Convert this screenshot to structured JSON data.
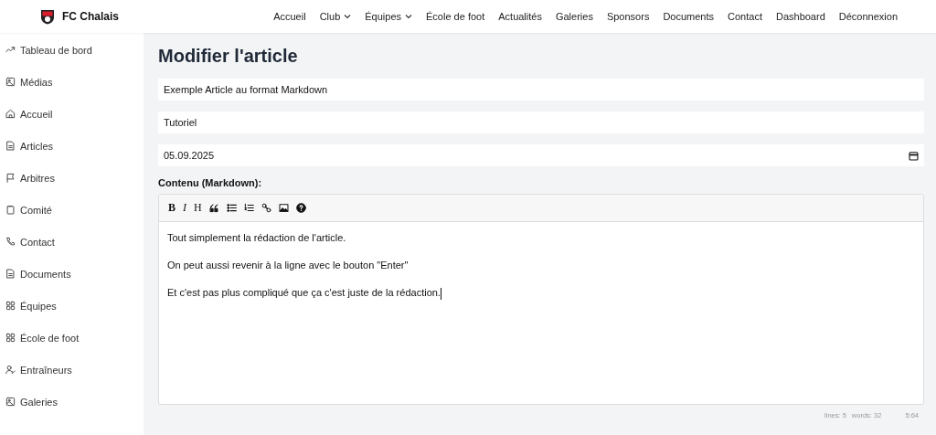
{
  "brand": {
    "name": "FC Chalais"
  },
  "nav": [
    {
      "label": "Accueil",
      "dropdown": false
    },
    {
      "label": "Club",
      "dropdown": true
    },
    {
      "label": "Équipes",
      "dropdown": true
    },
    {
      "label": "École de foot",
      "dropdown": false
    },
    {
      "label": "Actualités",
      "dropdown": false
    },
    {
      "label": "Galeries",
      "dropdown": false
    },
    {
      "label": "Sponsors",
      "dropdown": false
    },
    {
      "label": "Documents",
      "dropdown": false
    },
    {
      "label": "Contact",
      "dropdown": false
    },
    {
      "label": "Dashboard",
      "dropdown": false
    },
    {
      "label": "Déconnexion",
      "dropdown": false
    }
  ],
  "sidebar": {
    "items": [
      {
        "label": "Tableau de bord",
        "kind": "chart"
      },
      {
        "label": "Médias",
        "kind": "image"
      },
      {
        "label": "Accueil",
        "kind": "home"
      },
      {
        "label": "Articles",
        "kind": "document"
      },
      {
        "label": "Arbitres",
        "kind": "flag"
      },
      {
        "label": "Comité",
        "kind": "clipboard"
      },
      {
        "label": "Contact",
        "kind": "phone"
      },
      {
        "label": "Documents",
        "kind": "document"
      },
      {
        "label": "Équipes",
        "kind": "grid"
      },
      {
        "label": "École de foot",
        "kind": "grid"
      },
      {
        "label": "Entraîneurs",
        "kind": "user"
      },
      {
        "label": "Galeries",
        "kind": "image"
      }
    ]
  },
  "page": {
    "title": "Modifier l'article"
  },
  "form": {
    "title_field": {
      "value": "Exemple Article au format Markdown"
    },
    "category_field": {
      "value": "Tutoriel"
    },
    "date_field": {
      "value": "05.09.2025"
    },
    "content_label": "Contenu (Markdown):",
    "toolbar": [
      {
        "kind": "bold",
        "label": "B"
      },
      {
        "kind": "italic",
        "label": "I"
      },
      {
        "kind": "heading",
        "label": "H"
      },
      {
        "kind": "quote"
      },
      {
        "kind": "bullets"
      },
      {
        "kind": "numbers"
      },
      {
        "kind": "link"
      },
      {
        "kind": "image"
      },
      {
        "kind": "help"
      }
    ],
    "content": [
      "Tout simplement la rédaction de l'article.",
      "On peut aussi revenir à la ligne avec le bouton \"Enter\"",
      "Et c'est pas plus compliqué que ça c'est juste de la rédaction."
    ],
    "status": {
      "lines": "lines: 5",
      "words": "words: 32",
      "cursor": "5:64"
    }
  }
}
